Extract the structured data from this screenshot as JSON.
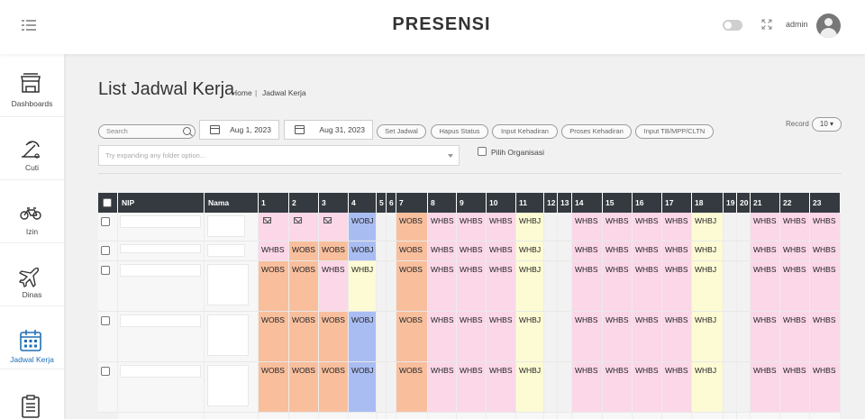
{
  "header": {
    "title": "PRESENSI",
    "user": "admin"
  },
  "sidebar": [
    {
      "label": "Dashboards",
      "icon": "store-icon",
      "active": false
    },
    {
      "label": "Cuti",
      "icon": "beach-icon",
      "active": false
    },
    {
      "label": "Izin",
      "icon": "bicycle-icon",
      "active": false
    },
    {
      "label": "Dinas",
      "icon": "airplane-icon",
      "active": false
    },
    {
      "label": "Jadwal Kerja",
      "icon": "calendar-icon",
      "active": true
    },
    {
      "label": "",
      "icon": "clipboard-icon",
      "active": false
    }
  ],
  "page": {
    "title": "List Jadwal Kerja",
    "breadcrumb": [
      "Home",
      "Jadwal Kerja"
    ]
  },
  "filters": {
    "search_placeholder": "Search",
    "date_from": "Aug 1, 2023",
    "date_to": "Aug 31, 2023",
    "buttons": [
      "Set Jadwal",
      "Hapus Status",
      "Input Kehadiran",
      "Proses Kehadiran",
      "Input TB/MPP/CLTN"
    ],
    "record_label": "Record",
    "record_value": "10",
    "tree_placeholder": "Try expanding any folder option...",
    "org_checkbox_label": "Pilih Organisasi"
  },
  "table": {
    "headers": [
      "NIP",
      "Nama",
      "1",
      "2",
      "3",
      "4",
      "5",
      "6",
      "7",
      "8",
      "9",
      "10",
      "11",
      "12",
      "13",
      "14",
      "15",
      "16",
      "17",
      "18",
      "19",
      "20",
      "21",
      "22",
      "23"
    ],
    "rows": [
      [
        "",
        "",
        "envelope",
        "envelope",
        "envelope",
        "WOBJ",
        "",
        "",
        "WOBS",
        "WHBS",
        "WHBS",
        "WHBS",
        "WHBJ",
        "",
        "",
        "WHBS",
        "WHBS",
        "WHBS",
        "WHBS",
        "WHBJ",
        "",
        "",
        "WHBS",
        "WHBS",
        "WHBS"
      ],
      [
        "",
        "",
        "WHBS",
        "WOBS",
        "WOBS",
        "WOBJ",
        "",
        "",
        "WOBS",
        "WHBS",
        "WHBS",
        "WHBS",
        "WHBJ",
        "",
        "",
        "WHBS",
        "WHBS",
        "WHBS",
        "WHBS",
        "WHBJ",
        "",
        "",
        "WHBS",
        "WHBS",
        "WHBS"
      ],
      [
        "",
        "",
        "WOBS",
        "WOBS",
        "WHBS",
        "WHBJ",
        "",
        "",
        "WOBS",
        "WHBS",
        "WHBS",
        "WHBS",
        "WHBJ",
        "",
        "",
        "WHBS",
        "WHBS",
        "WHBS",
        "WHBS",
        "WHBJ",
        "",
        "",
        "WHBS",
        "WHBS",
        "WHBS"
      ],
      [
        "",
        "",
        "WOBS",
        "WOBS",
        "WOBS",
        "WOBJ",
        "",
        "",
        "WOBS",
        "WHBS",
        "WHBS",
        "WHBS",
        "WHBJ",
        "",
        "",
        "WHBS",
        "WHBS",
        "WHBS",
        "WHBS",
        "WHBJ",
        "",
        "",
        "WHBS",
        "WHBS",
        "WHBS"
      ],
      [
        "",
        "",
        "WOBS",
        "WOBS",
        "WOBS",
        "WOBJ",
        "",
        "",
        "WOBS",
        "WHBS",
        "WHBS",
        "WHBS",
        "WHBJ",
        "",
        "",
        "WHBS",
        "WHBS",
        "WHBS",
        "WHBS",
        "WHBJ",
        "",
        "",
        "WHBS",
        "WHBS",
        "WHBS"
      ]
    ]
  },
  "colors": {
    "header_bg": "#343a40",
    "active_nav": "#1f6fb5",
    "code_colors": {
      "WOBS": "#f9bf9d",
      "WHBS": "#fbd7e8",
      "WHBJ": "#fdfbd4",
      "WOBJ": "#aabdf2",
      "empty": "#f2f2f2"
    }
  }
}
